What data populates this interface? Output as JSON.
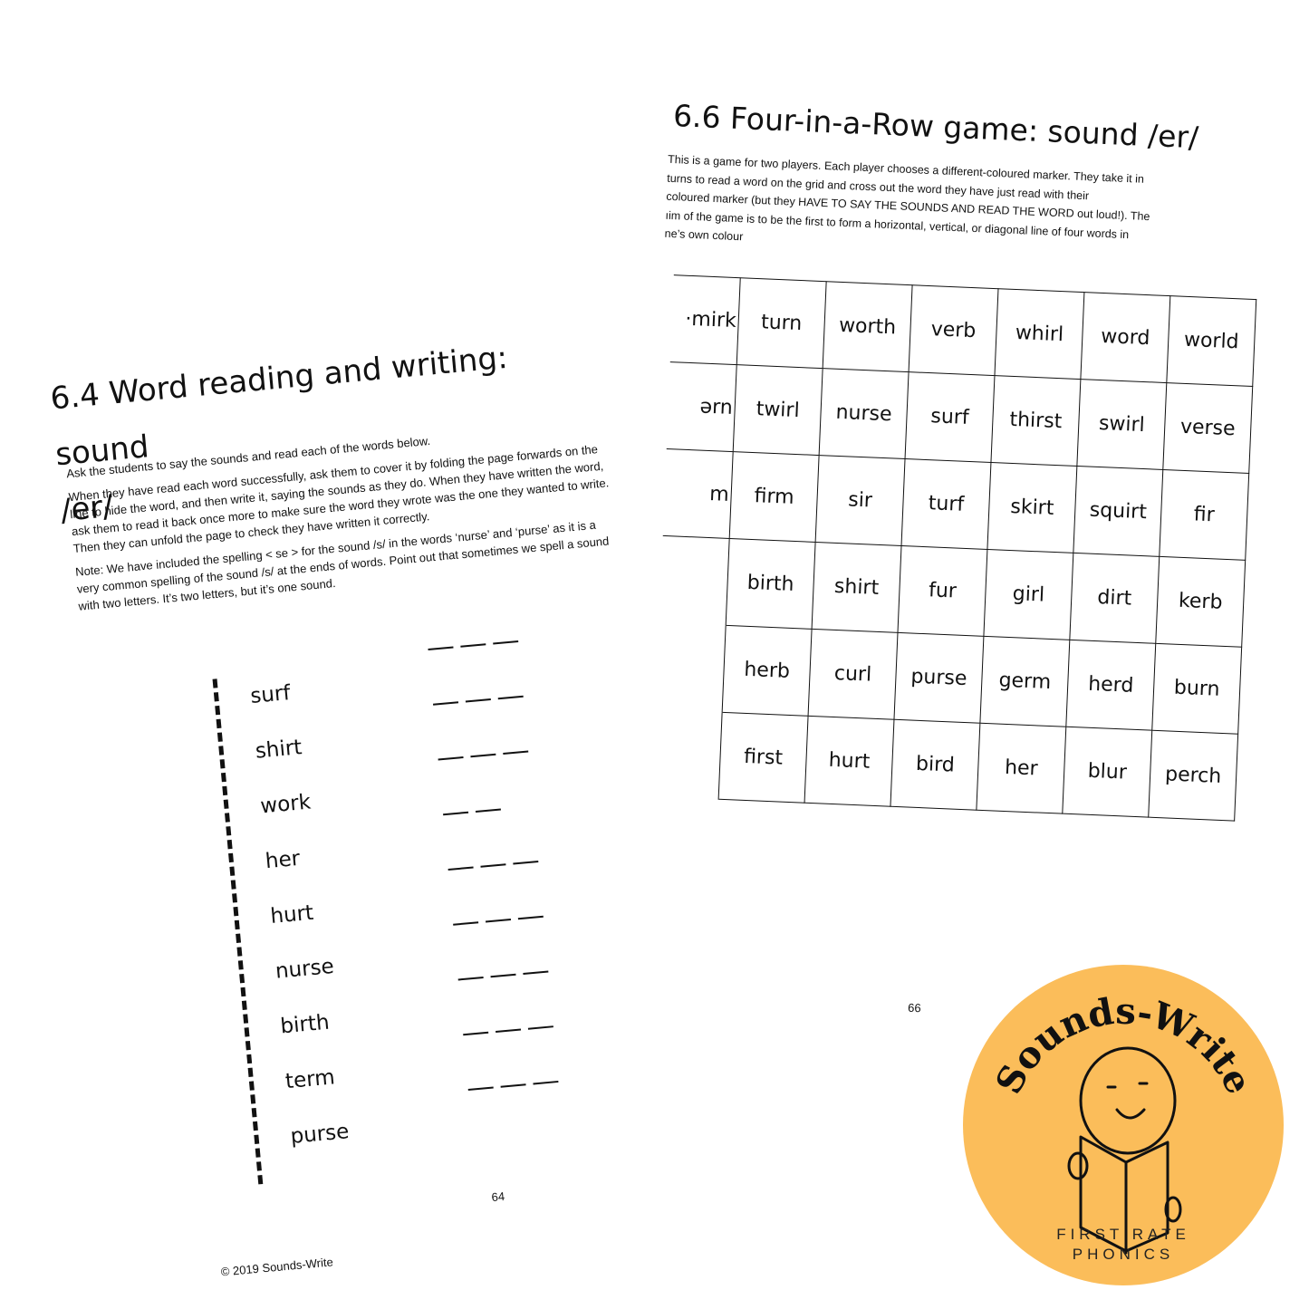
{
  "left_page": {
    "title": "6.4 Word reading and writing: sound /er/",
    "title_line1": "6.4 Word reading and writing: sound",
    "title_line2": "/er/",
    "paragraphs": [
      "Ask the students to say the sounds and read each of the words below.",
      "When they have read each word successfully, ask them to cover it by folding the page forwards on the line to hide the word, and then write it, saying the sounds as they do. When they have written the word, ask them to read it back once more to make sure the word they wrote was the one they wanted to write. Then they can unfold the page to check they have written it correctly.",
      "Note: We have included the spelling < se > for the sound /s/ in the words ‘nurse’ and ‘purse’ as it is a very common spelling of the sound /s/ at the ends of words. Point out that sometimes we spell a sound with two letters. It’s two letters, but it’s one sound."
    ],
    "words": [
      {
        "word": "surf",
        "blanks": 3
      },
      {
        "word": "shirt",
        "blanks": 3
      },
      {
        "word": "work",
        "blanks": 3
      },
      {
        "word": "her",
        "blanks": 2
      },
      {
        "word": "hurt",
        "blanks": 3
      },
      {
        "word": "nurse",
        "blanks": 3
      },
      {
        "word": "birth",
        "blanks": 3
      },
      {
        "word": "term",
        "blanks": 3
      },
      {
        "word": "purse",
        "blanks": 3
      }
    ],
    "page_number": "64",
    "copyright": "© 2019 Sounds-Write"
  },
  "right_page": {
    "title": "6.6 Four-in-a-Row game: sound /er/",
    "body_lines": [
      "This is a game for two players. Each player chooses a different-coloured marker. They take it in",
      "turns to read a word on the grid and cross out the word they have just read with their",
      "coloured marker (but they HAVE TO SAY THE SOUNDS AND READ THE WORD out loud!). The",
      "ıim of the game is to be the first to form a horizontal, vertical, or diagonal line of four words in",
      "ne’s own colour"
    ],
    "grid": [
      [
        "·mirk",
        "turn",
        "worth",
        "verb",
        "whirl",
        "word",
        "world"
      ],
      [
        "ərn",
        "twirl",
        "nurse",
        "surf",
        "thirst",
        "swirl",
        "verse"
      ],
      [
        "m",
        "firm",
        "sir",
        "turf",
        "skirt",
        "squirt",
        "fir"
      ],
      [
        "",
        "birth",
        "shirt",
        "fur",
        "girl",
        "dirt",
        "kerb"
      ],
      [
        "",
        "herb",
        "curl",
        "purse",
        "germ",
        "herd",
        "burn"
      ],
      [
        "",
        "first",
        "hurt",
        "bird",
        "her",
        "blur",
        "perch"
      ]
    ],
    "page_number": "66"
  },
  "logo": {
    "name": "Sounds-Write",
    "tagline_line1": "FIRST RATE",
    "tagline_line2": "PHONICS",
    "icon": "child-reading-book-icon",
    "background_color": "#fbbd5a"
  }
}
